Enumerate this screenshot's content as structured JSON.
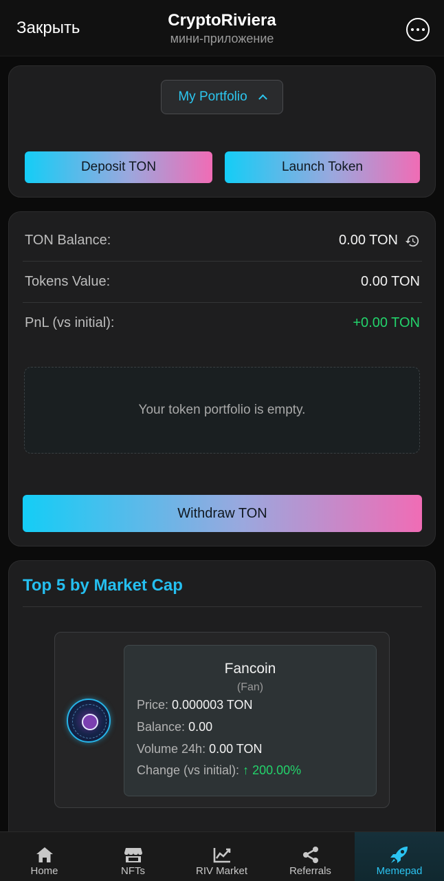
{
  "header": {
    "close_label": "Закрыть",
    "title": "CryptoRiviera",
    "subtitle": "мини-приложение"
  },
  "portfolio": {
    "selector_label": "My Portfolio",
    "deposit_label": "Deposit TON",
    "launch_label": "Launch Token"
  },
  "balances": {
    "rows": [
      {
        "label": "TON Balance:",
        "value": "0.00 TON"
      },
      {
        "label": "Tokens Value:",
        "value": "0.00 TON"
      },
      {
        "label": "PnL (vs initial):",
        "value": "+0.00 TON"
      }
    ],
    "empty_message": "Your token portfolio is empty.",
    "withdraw_label": "Withdraw TON"
  },
  "top5": {
    "title": "Top 5 by Market Cap",
    "tokens": [
      {
        "name": "Fancoin",
        "symbol": "(Fan)",
        "price_label": "Price:",
        "price": "0.000003 TON",
        "balance_label": "Balance:",
        "balance": "0.00",
        "volume_label": "Volume 24h:",
        "volume": "0.00 TON",
        "change_label": "Change (vs initial):",
        "change": "↑ 200.00%"
      }
    ]
  },
  "nav": {
    "items": [
      {
        "label": "Home",
        "icon": "home-icon"
      },
      {
        "label": "NFTs",
        "icon": "store-icon"
      },
      {
        "label": "RIV Market",
        "icon": "chart-line-icon"
      },
      {
        "label": "Referrals",
        "icon": "share-icon"
      },
      {
        "label": "Memepad",
        "icon": "rocket-icon"
      }
    ],
    "active": "Memepad"
  },
  "colors": {
    "accent": "#25bff0",
    "positive": "#23d36b",
    "gradient_start": "#14cdf6",
    "gradient_end": "#f06cb5"
  }
}
